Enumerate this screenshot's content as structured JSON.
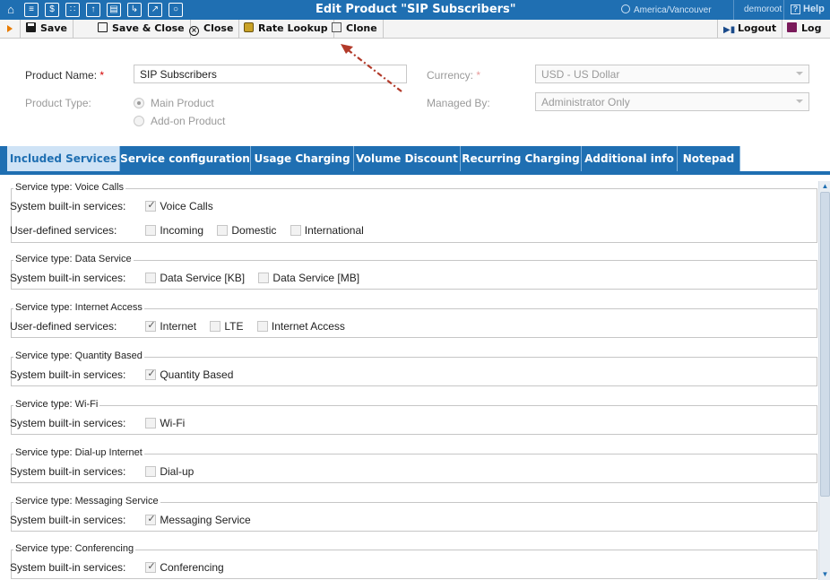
{
  "topbar": {
    "title": "Edit Product \"SIP Subscribers\"",
    "timezone": "America/Vancouver",
    "user": "demoroot",
    "help": "Help",
    "icons": [
      "home-icon",
      "list-icon",
      "dollar-icon",
      "grid-icon",
      "upload-icon",
      "table-icon",
      "import-icon",
      "chart-icon",
      "search-icon"
    ]
  },
  "toolbar": {
    "save": "Save",
    "save_close": "Save & Close",
    "close": "Close",
    "rate_lookup": "Rate Lookup",
    "clone": "Clone",
    "logout": "Logout",
    "log": "Log"
  },
  "form": {
    "product_name_label": "Product Name:",
    "product_name_value": "SIP Subscribers",
    "product_type_label": "Product Type:",
    "product_type_options": [
      "Main Product",
      "Add-on Product"
    ],
    "currency_label": "Currency:",
    "currency_value": "USD - US Dollar",
    "managed_by_label": "Managed By:",
    "managed_by_value": "Administrator Only",
    "required_mark": "*"
  },
  "tabs": [
    "Included Services",
    "Service configuration",
    "Usage Charging",
    "Volume Discount",
    "Recurring Charging",
    "Additional info",
    "Notepad"
  ],
  "services": [
    {
      "title": "Service type: Voice Calls",
      "rows": [
        {
          "label": "System built-in services:",
          "options": [
            {
              "text": "Voice Calls",
              "checked": true
            }
          ]
        },
        {
          "label": "User-defined services:",
          "options": [
            {
              "text": "Incoming",
              "checked": false
            },
            {
              "text": "Domestic",
              "checked": false
            },
            {
              "text": "International",
              "checked": false
            }
          ]
        }
      ]
    },
    {
      "title": "Service type: Data Service",
      "rows": [
        {
          "label": "System built-in services:",
          "options": [
            {
              "text": "Data Service [KB]",
              "checked": false
            },
            {
              "text": "Data Service [MB]",
              "checked": false
            }
          ]
        }
      ]
    },
    {
      "title": "Service type: Internet Access",
      "rows": [
        {
          "label": "User-defined services:",
          "options": [
            {
              "text": "Internet",
              "checked": true
            },
            {
              "text": "LTE",
              "checked": false
            },
            {
              "text": "Internet Access",
              "checked": false
            }
          ]
        }
      ]
    },
    {
      "title": "Service type: Quantity Based",
      "rows": [
        {
          "label": "System built-in services:",
          "options": [
            {
              "text": "Quantity Based",
              "checked": true
            }
          ]
        }
      ]
    },
    {
      "title": "Service type: Wi-Fi",
      "rows": [
        {
          "label": "System built-in services:",
          "options": [
            {
              "text": "Wi-Fi",
              "checked": false
            }
          ]
        }
      ]
    },
    {
      "title": "Service type: Dial-up Internet",
      "rows": [
        {
          "label": "System built-in services:",
          "options": [
            {
              "text": "Dial-up",
              "checked": false
            }
          ]
        }
      ]
    },
    {
      "title": "Service type: Messaging Service",
      "rows": [
        {
          "label": "System built-in services:",
          "options": [
            {
              "text": "Messaging Service",
              "checked": true
            }
          ]
        }
      ]
    },
    {
      "title": "Service type: Conferencing",
      "rows": [
        {
          "label": "System built-in services:",
          "options": [
            {
              "text": "Conferencing",
              "checked": true
            }
          ]
        }
      ]
    }
  ],
  "colors": {
    "brand_blue": "#1f6fb2",
    "active_tab": "#cfe3f6",
    "play_orange": "#e87b00",
    "annotation_arrow": "#b23a2a"
  }
}
